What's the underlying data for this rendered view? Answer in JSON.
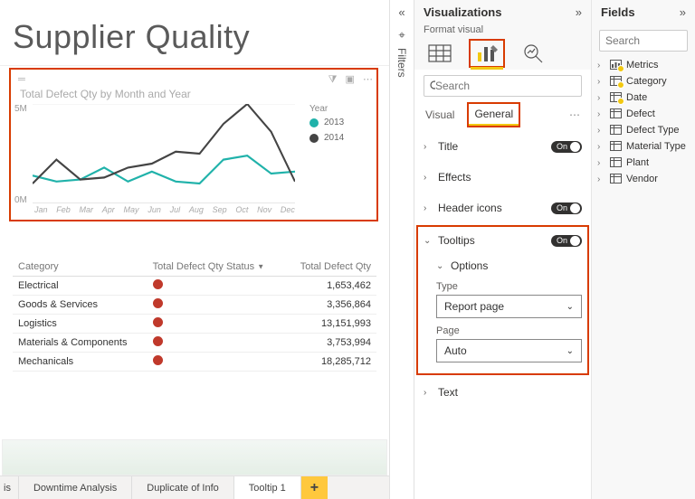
{
  "page_title": "Supplier Quality",
  "chart_data": {
    "type": "line",
    "title": "Total Defect Qty by Month and Year",
    "categories": [
      "Jan",
      "Feb",
      "Mar",
      "Apr",
      "May",
      "Jun",
      "Jul",
      "Aug",
      "Sep",
      "Oct",
      "Nov",
      "Dec"
    ],
    "series": [
      {
        "name": "2013",
        "color": "#20b2aa",
        "values": [
          1.4,
          1.1,
          1.2,
          1.8,
          1.1,
          1.6,
          1.1,
          1.0,
          2.2,
          2.4,
          1.5,
          1.6
        ]
      },
      {
        "name": "2014",
        "color": "#444444",
        "values": [
          1.0,
          2.2,
          1.2,
          1.3,
          1.8,
          2.0,
          2.6,
          2.5,
          4.0,
          5.0,
          3.6,
          1.1
        ]
      }
    ],
    "ylabel": "",
    "ylim": [
      0,
      5
    ],
    "yticks": [
      {
        "v": 0,
        "label": "0M"
      },
      {
        "v": 5,
        "label": "5M"
      }
    ],
    "legend_title": "Year"
  },
  "table": {
    "cols": [
      "Category",
      "Total Defect Qty Status",
      "Total Defect Qty"
    ],
    "sort_col": 1,
    "rows": [
      {
        "cat": "Electrical",
        "status": "red",
        "qty": "1,653,462"
      },
      {
        "cat": "Goods & Services",
        "status": "red",
        "qty": "3,356,864"
      },
      {
        "cat": "Logistics",
        "status": "red",
        "qty": "13,151,993"
      },
      {
        "cat": "Materials & Components",
        "status": "red",
        "qty": "3,753,994"
      },
      {
        "cat": "Mechanicals",
        "status": "red",
        "qty": "18,285,712"
      }
    ]
  },
  "page_tabs": {
    "cut": "is",
    "items": [
      "Downtime Analysis",
      "Duplicate of Info",
      "Tooltip 1"
    ],
    "active": 3,
    "add": "+"
  },
  "filters": {
    "label": "Filters"
  },
  "viz": {
    "title": "Visualizations",
    "subtitle": "Format visual",
    "search_placeholder": "Search",
    "tabs": {
      "visual": "Visual",
      "general": "General"
    },
    "cards": {
      "title": {
        "label": "Title",
        "on": "On"
      },
      "effects": {
        "label": "Effects"
      },
      "header_icons": {
        "label": "Header icons",
        "on": "On"
      },
      "tooltips": {
        "label": "Tooltips",
        "on": "On",
        "options_label": "Options",
        "type_label": "Type",
        "type_value": "Report page",
        "page_label": "Page",
        "page_value": "Auto"
      },
      "text": {
        "label": "Text"
      }
    }
  },
  "fields": {
    "title": "Fields",
    "search_placeholder": "Search",
    "tables": [
      {
        "name": "Metrics",
        "checked": true,
        "icon": "metrics"
      },
      {
        "name": "Category",
        "checked": true
      },
      {
        "name": "Date",
        "checked": true
      },
      {
        "name": "Defect",
        "checked": false
      },
      {
        "name": "Defect Type",
        "checked": false
      },
      {
        "name": "Material Type",
        "checked": false
      },
      {
        "name": "Plant",
        "checked": false
      },
      {
        "name": "Vendor",
        "checked": false
      }
    ]
  }
}
